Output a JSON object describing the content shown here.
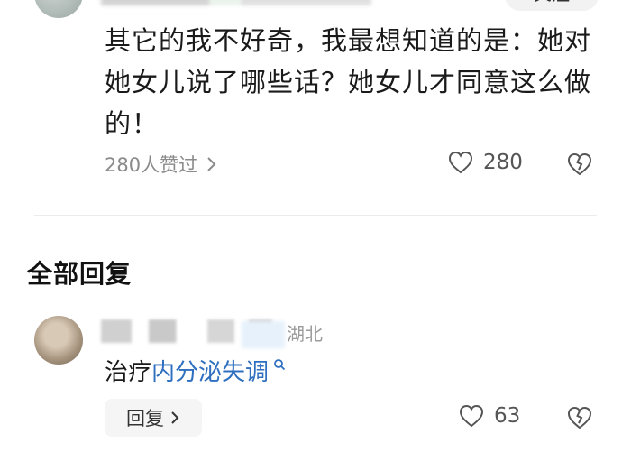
{
  "top_comment": {
    "follow_label": "关注",
    "text": "其它的我不好奇，我最想知道的是：她对她女儿说了哪些话？她女儿才同意这么做的！",
    "liked_by": "280人赞过",
    "like_count": "280"
  },
  "section_title": "全部回复",
  "reply": {
    "location": "湖北",
    "text_prefix": "治疗",
    "link_text": "内分泌失调",
    "reply_button_label": "回复",
    "like_count": "63"
  },
  "icons": {
    "like": "heart-icon",
    "dislike": "broken-heart-icon",
    "search_hint": "magnifier-icon",
    "chevron": "chevron-right-icon"
  },
  "colors": {
    "link": "#2f6fbf",
    "muted": "#8a8a8a",
    "text": "#1a1a1a"
  }
}
